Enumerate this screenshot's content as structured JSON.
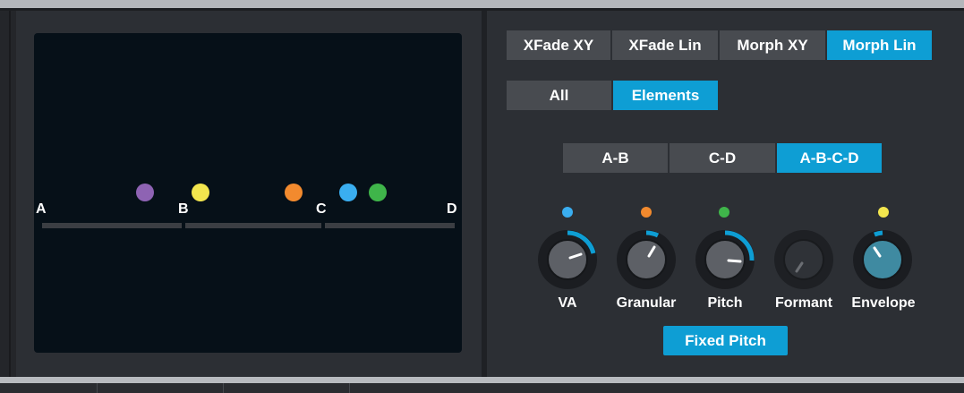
{
  "mode_tabs": [
    {
      "label": "XFade XY",
      "active": false
    },
    {
      "label": "XFade Lin",
      "active": false
    },
    {
      "label": "Morph XY",
      "active": false
    },
    {
      "label": "Morph Lin",
      "active": true
    }
  ],
  "scope_tabs": [
    {
      "label": "All",
      "active": false
    },
    {
      "label": "Elements",
      "active": true
    }
  ],
  "segment_tabs": [
    {
      "label": "A-B",
      "active": false
    },
    {
      "label": "C-D",
      "active": false
    },
    {
      "label": "A-B-C-D",
      "active": true
    }
  ],
  "morph_track": {
    "labels": [
      "A",
      "B",
      "C",
      "D"
    ]
  },
  "knobs": [
    {
      "label": "VA",
      "indicator_color": "#3aaef0",
      "enabled": true
    },
    {
      "label": "Granular",
      "indicator_color": "#f28a2e",
      "enabled": true
    },
    {
      "label": "Pitch",
      "indicator_color": "#3fb54a",
      "enabled": true
    },
    {
      "label": "Formant",
      "indicator_color": "",
      "enabled": false
    },
    {
      "label": "Envelope",
      "indicator_color": "#f3e64e",
      "enabled": true
    }
  ],
  "dot_colors": {
    "purple": "#8e63b3",
    "yellow": "#f3e64e",
    "orange": "#f28a2e",
    "blue": "#3aaef0",
    "green": "#3fb54a"
  },
  "fixed_pitch_label": "Fixed Pitch",
  "accent_color": "#0e9ed4"
}
